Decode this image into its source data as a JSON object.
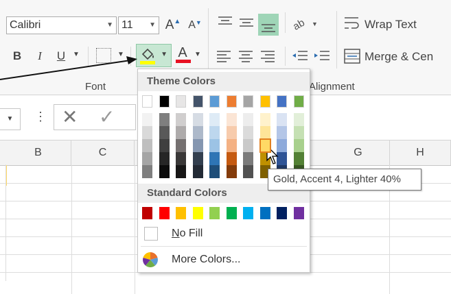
{
  "ribbon": {
    "font_name": "Calibri",
    "font_size": "11",
    "increase_font_glyph": "A",
    "decrease_font_glyph": "A",
    "bold": "B",
    "italic": "I",
    "underline": "U",
    "font_color_glyph": "A",
    "font_group_label": "Font",
    "alignment_group_label": "Alignment",
    "wrap_text_label": "Wrap Text",
    "merge_center_label": "Merge & Cen"
  },
  "formula_bar": {
    "cancel_glyph": "✕",
    "enter_glyph": "✓",
    "more_glyph": "⋮"
  },
  "columns": [
    "B",
    "C",
    "G",
    "H"
  ],
  "palette": {
    "theme_title": "Theme Colors",
    "standard_title": "Standard Colors",
    "no_fill_label": "No Fill",
    "no_fill_mnemonic": "N",
    "more_colors_label": "More Colors...",
    "more_colors_mnemonic": "M",
    "theme_base": [
      "#ffffff",
      "#000000",
      "#e7e6e6",
      "#44546a",
      "#5b9bd5",
      "#ed7d31",
      "#a5a5a5",
      "#ffc000",
      "#4472c4",
      "#70ad47"
    ],
    "theme_shades": [
      [
        "#f2f2f2",
        "#7f7f7f",
        "#d0cece",
        "#d6dce4",
        "#deebf6",
        "#fbe5d5",
        "#ededed",
        "#fff2cc",
        "#dae3f3",
        "#e2efd9"
      ],
      [
        "#d9d9d9",
        "#595959",
        "#aeabab",
        "#adb9ca",
        "#bdd7ee",
        "#f7cbac",
        "#dbdbdb",
        "#fee599",
        "#b4c6e7",
        "#c5e0b3"
      ],
      [
        "#bfbfbf",
        "#3f3f3f",
        "#757070",
        "#8496b0",
        "#9cc3e5",
        "#f4b183",
        "#c9c9c9",
        "#ffd965",
        "#8eaadb",
        "#a8d08d"
      ],
      [
        "#a5a5a5",
        "#262626",
        "#3a3838",
        "#323f4f",
        "#2e75b5",
        "#c55a11",
        "#7b7b7b",
        "#bf9000",
        "#2f5496",
        "#538135"
      ],
      [
        "#7f7f7f",
        "#0c0c0c",
        "#171616",
        "#222a35",
        "#1e4e79",
        "#843c0b",
        "#525252",
        "#7f6000",
        "#1f3864",
        "#375623"
      ]
    ],
    "standard": [
      "#c00000",
      "#ff0000",
      "#ffc000",
      "#ffff00",
      "#92d050",
      "#00b050",
      "#00b0f0",
      "#0070c0",
      "#002060",
      "#7030a0"
    ]
  },
  "tooltip": "Gold, Accent 4, Lighter 40%",
  "colors": {
    "fill_highlight": "#ffff00",
    "font_color_bar": "#e81123",
    "selected_button": "#9fd5b7"
  }
}
